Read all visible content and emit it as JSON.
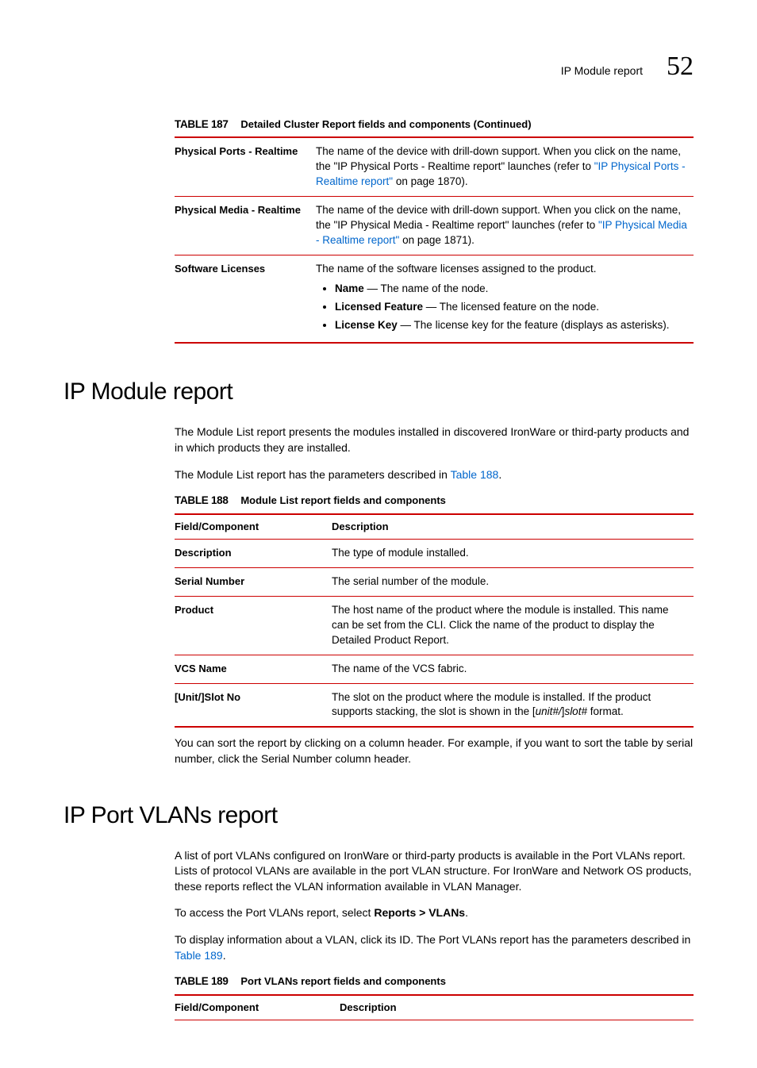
{
  "header": {
    "title": "IP Module report",
    "chapter": "52"
  },
  "table187": {
    "label": "TABLE 187",
    "caption": "Detailed Cluster Report fields and components (Continued)",
    "rows": {
      "r1": {
        "field": "Physical Ports - Realtime",
        "desc_a": "The name of the device with drill-down support. When you click on the name, the \"IP Physical Ports - Realtime report\" launches (refer to ",
        "link": "\"IP Physical Ports - Realtime report\"",
        "desc_b": " on page 1870)."
      },
      "r2": {
        "field": "Physical Media - Realtime",
        "desc_a": "The name of the device with drill-down support. When you click on the name, the \"IP Physical Media - Realtime report\" launches (refer to ",
        "link": "\"IP Physical Media - Realtime report\"",
        "desc_b": " on page 1871)."
      },
      "r3": {
        "field": "Software Licenses",
        "intro": "The name of the software licenses assigned to the product.",
        "b1_label": "Name",
        "b1_rest": " — The name of the node.",
        "b2_label": "Licensed Feature",
        "b2_rest": " — The licensed feature on the node.",
        "b3_label": "License Key",
        "b3_rest": " — The license key for the feature (displays as asterisks)."
      }
    }
  },
  "module": {
    "heading": "IP Module report",
    "para1": "The Module List report presents the modules installed in discovered IronWare or third-party products and in which products they are installed.",
    "para2_a": "The Module List report has the parameters described in ",
    "para2_link": "Table 188",
    "para2_b": ".",
    "table": {
      "label": "TABLE 188",
      "caption": "Module List report fields and components",
      "hdr_field": "Field/Component",
      "hdr_desc": "Description",
      "rows": {
        "r1": {
          "f": "Description",
          "d": "The type of module installed."
        },
        "r2": {
          "f": "Serial Number",
          "d": "The serial number of the module."
        },
        "r3": {
          "f": "Product",
          "d": "The host name of the product where the module is installed. This name can be set from the CLI. Click the name of the product to display the Detailed Product Report."
        },
        "r4": {
          "f": "VCS Name",
          "d": "The name of the VCS fabric."
        },
        "r5": {
          "f": "[Unit/]Slot No",
          "d_a": "The slot on the product where the module is installed. If the product supports stacking, the slot is shown in the [",
          "d_unit": "unit#/",
          "d_b": "]",
          "d_slot": "slot#",
          "d_c": " format."
        }
      }
    },
    "para3": "You can sort the report by clicking on a column header. For example, if you want to sort the table by serial number, click the Serial Number column header."
  },
  "vlans": {
    "heading": "IP Port VLANs report",
    "para1": "A list of port VLANs configured on IronWare or third-party products is available in the Port VLANs report. Lists of protocol VLANs are available in the port VLAN structure. For IronWare and Network OS products, these reports reflect the VLAN information available in VLAN Manager.",
    "para2_a": "To access the Port VLANs report, select ",
    "para2_bold": "Reports > VLANs",
    "para2_b": ".",
    "para3_a": "To display information about a VLAN, click its ID. The Port VLANs report has the parameters described in ",
    "para3_link": "Table 189",
    "para3_b": ".",
    "table": {
      "label": "TABLE 189",
      "caption": "Port VLANs report fields and components",
      "hdr_field": "Field/Component",
      "hdr_desc": "Description"
    }
  }
}
